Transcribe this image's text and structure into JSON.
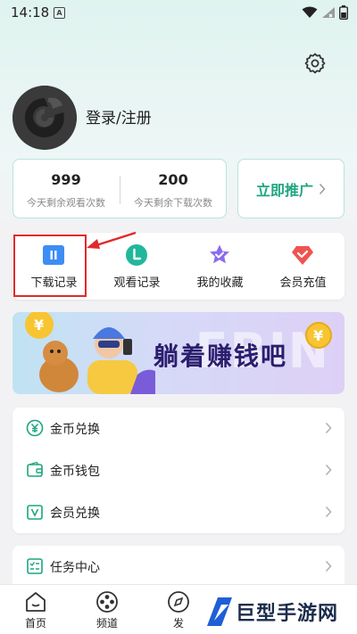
{
  "status_bar": {
    "time": "14:18",
    "sim_label": "A"
  },
  "profile": {
    "login_text": "登录/注册"
  },
  "stats": [
    {
      "value": "999",
      "label": "今天剩余观看次数"
    },
    {
      "value": "200",
      "label": "今天剩余下载次数"
    }
  ],
  "promote": {
    "label": "立即推广"
  },
  "quick_actions": [
    {
      "label": "下载记录",
      "icon": "download-record-icon"
    },
    {
      "label": "观看记录",
      "icon": "watch-history-icon"
    },
    {
      "label": "我的收藏",
      "icon": "favorite-star-icon"
    },
    {
      "label": "会员充值",
      "icon": "vip-recharge-icon"
    }
  ],
  "banner": {
    "slogan": "躺着赚钱吧",
    "ghost_text": "EBIN"
  },
  "menu": [
    {
      "label": "金币兑换",
      "icon": "coin-exchange-icon"
    },
    {
      "label": "金币钱包",
      "icon": "wallet-icon"
    },
    {
      "label": "会员兑换",
      "icon": "vip-exchange-icon"
    }
  ],
  "menu2": [
    {
      "label": "任务中心",
      "icon": "task-list-icon"
    }
  ],
  "bottom_nav": [
    {
      "label": "首页",
      "icon": "home-icon"
    },
    {
      "label": "频道",
      "icon": "channel-reel-icon"
    },
    {
      "label": "发",
      "icon": "discover-icon"
    }
  ],
  "watermark": {
    "text": "巨型手游网"
  },
  "colors": {
    "accent": "#1ea57f",
    "highlight_box": "#e02a2a",
    "star": "#8d6bf0",
    "vip": "#f0534f",
    "download": "#3d8df5"
  }
}
